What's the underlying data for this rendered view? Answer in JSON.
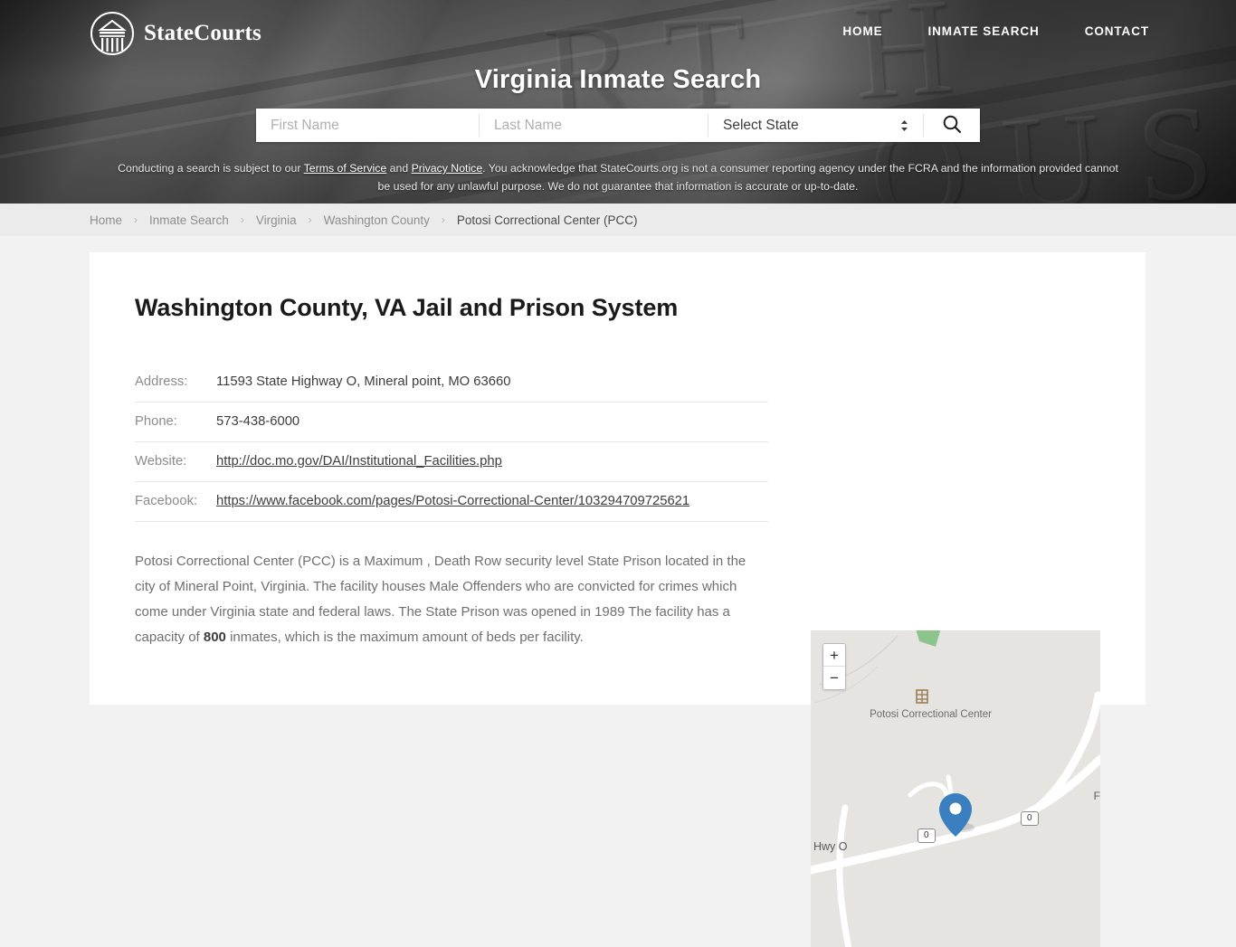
{
  "header": {
    "brand": "StateCourts",
    "logo_icon": "courthouse-circle-logo",
    "nav": [
      {
        "label": "HOME"
      },
      {
        "label": "INMATE SEARCH"
      },
      {
        "label": "CONTACT"
      }
    ],
    "title": "Virginia Inmate Search",
    "search": {
      "first_name_placeholder": "First Name",
      "first_name_value": "",
      "last_name_placeholder": "Last Name",
      "last_name_value": "",
      "state_selected": "Select State",
      "stepper_icon": "chevron-up-down-icon",
      "search_icon": "search-icon"
    },
    "disclaimer": {
      "part1": "Conducting a search is subject to our ",
      "link1": "Terms of Service",
      "mid": " and ",
      "link2": "Privacy Notice",
      "part2": ". You acknowledge that StateCourts.org is not a consumer reporting agency under the FCRA and the information provided cannot be used for any unlawful purpose. We do not guarantee that information is accurate or up-to-date."
    }
  },
  "breadcrumb": {
    "items": [
      {
        "label": "Home",
        "current": false
      },
      {
        "label": "Inmate Search",
        "current": false
      },
      {
        "label": "Virginia",
        "current": false
      },
      {
        "label": "Washington County",
        "current": false
      },
      {
        "label": "Potosi Correctional Center (PCC)",
        "current": true
      }
    ],
    "separator": "›"
  },
  "main": {
    "page_title": "Washington County, VA Jail and Prison System",
    "details": [
      {
        "label": "Address:",
        "value": "11593 State Highway O, Mineral point, MO 63660",
        "is_link": false
      },
      {
        "label": "Phone:",
        "value": "573-438-6000",
        "is_link": false
      },
      {
        "label": "Website:",
        "value": "http://doc.mo.gov/DAI/Institutional_Facilities.php",
        "is_link": true
      },
      {
        "label": "Facebook:",
        "value": "https://www.facebook.com/pages/Potosi-Correctional-Center/103294709725621",
        "is_link": true
      }
    ],
    "description": {
      "before": "Potosi Correctional Center (PCC) is a Maximum , Death Row security level State Prison located in the city of Mineral Point, Virginia. The facility houses Male Offenders who are convicted for crimes which come under Virginia state and federal laws. The State Prison was opened in 1989 The facility has a capacity of ",
      "capacity": "800",
      "after": " inmates, which is the maximum amount of beds per facility."
    }
  },
  "map": {
    "zoom_in_label": "+",
    "zoom_out_label": "−",
    "poi_label": "Potosi Correctional Center",
    "poi_icon": "building-poi-icon",
    "marker_icon": "map-pin-marker",
    "road_label": "Hwy O",
    "shield_a": "0",
    "shield_b": "0",
    "edge_letter": "F",
    "colors": {
      "land": "#e6e4e0",
      "road": "#ffffff",
      "park": "#8cc48c",
      "marker": "#3a7fbf"
    }
  }
}
